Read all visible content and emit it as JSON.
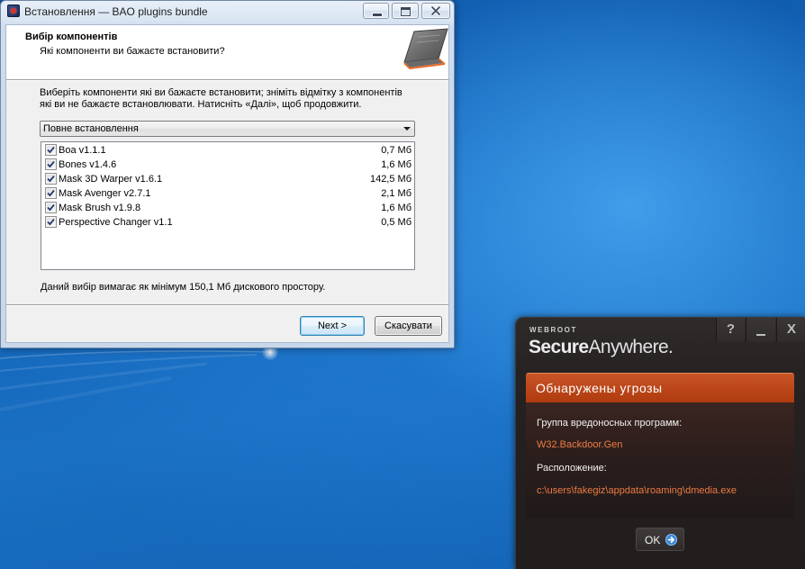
{
  "installer": {
    "title": "Встановлення — BAO plugins bundle",
    "heading": "Вибір компонентів",
    "subheading": "Які компоненти ви бажаєте встановити?",
    "instructions": [
      "Виберіть компоненти які ви бажаєте встановити; зніміть відмітку з компонентів",
      "які ви не бажаєте встановлювати. Натисніть «Далі», щоб продовжити."
    ],
    "install_type": "Повне встановлення",
    "components": [
      {
        "label": "Boa v1.1.1",
        "size": "0,7 Мб",
        "checked": true
      },
      {
        "label": "Bones v1.4.6",
        "size": "1,6 Мб",
        "checked": true
      },
      {
        "label": "Mask 3D Warper v1.6.1",
        "size": "142,5 Мб",
        "checked": true
      },
      {
        "label": "Mask Avenger v2.7.1",
        "size": "2,1 Мб",
        "checked": true
      },
      {
        "label": "Mask Brush v1.9.8",
        "size": "1,6 Мб",
        "checked": true
      },
      {
        "label": "Perspective Changer v1.1",
        "size": "0,5 Мб",
        "checked": true
      }
    ],
    "disk_space_note": "Даний вибір вимагає як мінімум 150,1 Мб дискового простору.",
    "next_button": "Next >",
    "cancel_button": "Скасувати"
  },
  "webroot_alert": {
    "brand": "WEBROOT",
    "product_name_bold": "Secure",
    "product_name_light": "Anywhere.",
    "help_button": "?",
    "close_button": "X",
    "alert_title": "Обнаружены угрозы",
    "threat_group_label": "Группа вредоносных программ:",
    "threat_group_value": "W32.Backdoor.Gen",
    "location_label": "Расположение:",
    "location_value": "c:\\users\\fakegiz\\appdata\\roaming\\dmedia.exe",
    "ok_button": "OK"
  },
  "icons": {
    "installer_app": "installer-app-icon",
    "window_minimize": "minimize-icon",
    "window_maximize": "maximize-icon",
    "window_close": "close-icon",
    "header_art": "installer-header-image",
    "dropdown": "chevron-down-icon",
    "checkbox": "checkmark-icon",
    "alert_minimize": "minimize-icon",
    "ok_arrow": "arrow-right-circle-icon"
  },
  "colors": {
    "desktop_blue": "#1466ba",
    "alert_banner": "#c2410f",
    "alert_value_text": "#ee7b42",
    "default_button_border": "#3c7fb1",
    "ok_icon_blue": "#3a86d6"
  }
}
